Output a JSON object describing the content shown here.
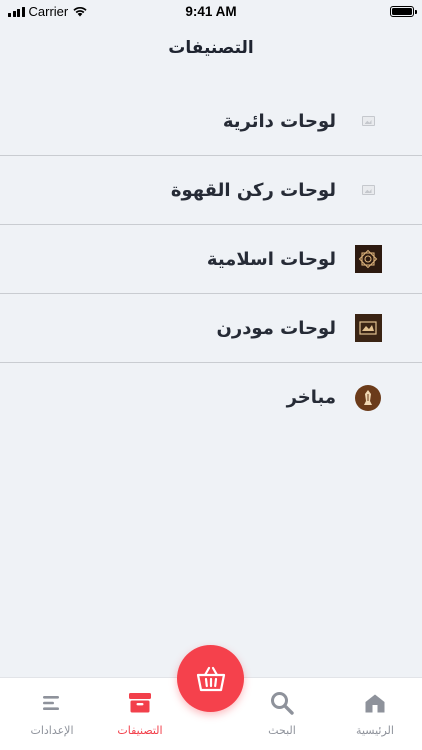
{
  "status_bar": {
    "carrier": "Carrier",
    "time": "9:41 AM"
  },
  "header": {
    "title": "التصنيفات"
  },
  "categories": [
    {
      "label": "لوحات دائرية",
      "thumb": "placeholder-image-icon"
    },
    {
      "label": "لوحات ركن القهوة",
      "thumb": "placeholder-image-icon"
    },
    {
      "label": "لوحات اسلامية",
      "thumb": "islamic-art-thumbnail"
    },
    {
      "label": "لوحات مودرن",
      "thumb": "modern-art-thumbnail"
    },
    {
      "label": "مباخر",
      "thumb": "incense-burner-thumbnail"
    }
  ],
  "tabs": {
    "settings": "الإعدادات",
    "categories": "التصنيفات",
    "search": "البحث",
    "home": "الرئيسية"
  },
  "colors": {
    "accent": "#f5414c",
    "background": "#eff2f6",
    "tab_inactive": "#8e929b"
  }
}
